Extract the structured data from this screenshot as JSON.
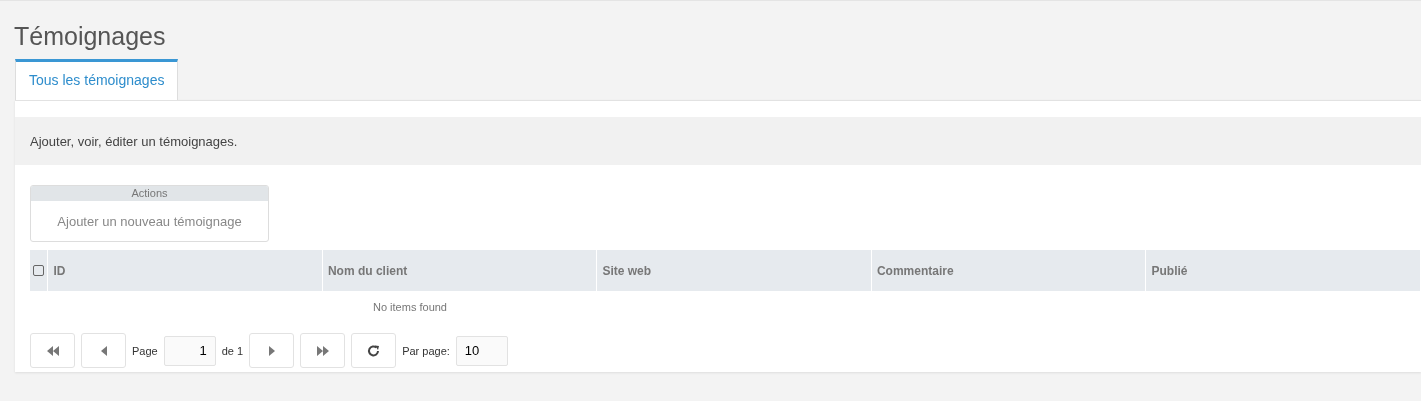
{
  "page_title": "Témoignages",
  "tabs": [
    {
      "label": "Tous les témoignages",
      "selected": true
    }
  ],
  "description": "Ajouter, voir, éditer un témoignages.",
  "actions": {
    "title": "Actions",
    "items": [
      "Ajouter un nouveau témoignage"
    ]
  },
  "table": {
    "select_all": {
      "checked": false
    },
    "columns": [
      "ID",
      "Nom du client",
      "Site web",
      "Commentaire",
      "Publié"
    ],
    "empty_message": "No items found"
  },
  "pager": {
    "nav_before": [
      {
        "kind": "first"
      },
      {
        "kind": "prev"
      }
    ],
    "page_label": "Page",
    "page_value": "1",
    "of_label": "de 1",
    "nav_after": [
      {
        "kind": "next"
      },
      {
        "kind": "last"
      },
      {
        "kind": "refresh"
      }
    ],
    "per_page_label": "Par page:",
    "per_page_value": "10"
  }
}
